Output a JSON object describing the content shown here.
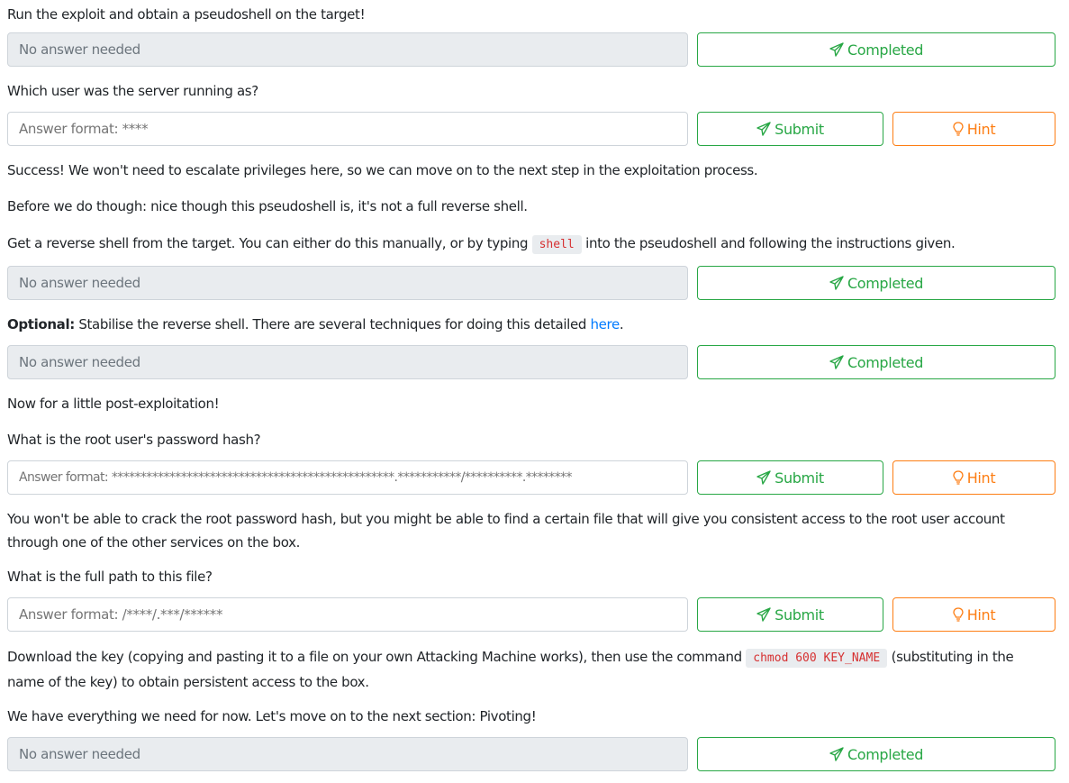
{
  "tasks": {
    "t1_text": "Run the exploit and obtain a pseudoshell on the target!",
    "t1_input": "No answer needed",
    "t1_button": "Completed",
    "t2_text": "Which user was the server running as?",
    "t2_placeholder": "Answer format: ****",
    "t2_submit": "Submit",
    "t2_hint": "Hint",
    "p1": "Success! We won't need to escalate privileges here, so we can move on to the next step in the exploitation process.",
    "p2": "Before we do though: nice though this pseudoshell is, it's not a full reverse shell.",
    "t3_text_before": "Get a reverse shell from the target. You can either do this manually, or by typing ",
    "t3_code": "shell",
    "t3_text_after": " into the pseudoshell and following the instructions given.",
    "t3_input": "No answer needed",
    "t3_button": "Completed",
    "t4_bold": "Optional:",
    "t4_text": " Stabilise the reverse shell. There are several techniques for doing this detailed ",
    "t4_link": "here",
    "t4_end": ".",
    "t4_input": "No answer needed",
    "t4_button": "Completed",
    "p3": "Now for a little post-exploitation!",
    "t5_text": "What is the root user's password hash?",
    "t5_placeholder": "Answer format: *************************************************.***********/**********.********",
    "t5_submit": "Submit",
    "t5_hint": "Hint",
    "p4": "You won't be able to crack the root password hash, but you might be able to find a certain file that will give you consistent access to the root user account through one of the other services on the box.",
    "t6_text": "What is the full path to this file?",
    "t6_placeholder": "Answer format: /****/.***/******",
    "t6_submit": "Submit",
    "t6_hint": "Hint",
    "p5_before": "Download the key (copying and pasting it to a file on your own Attacking Machine works), then use the command ",
    "p5_code": "chmod 600 KEY_NAME",
    "p5_after": " (substituting in the name of the key) to obtain persistent access to the box.",
    "p6": "We have everything we need for now. Let's move on to the next section: Pivoting!",
    "t7_input": "No answer needed",
    "t7_button": "Completed"
  },
  "colors": {
    "success": "#28a745",
    "hint": "#fd7e14",
    "link": "#007bff",
    "code": "#d63031"
  }
}
